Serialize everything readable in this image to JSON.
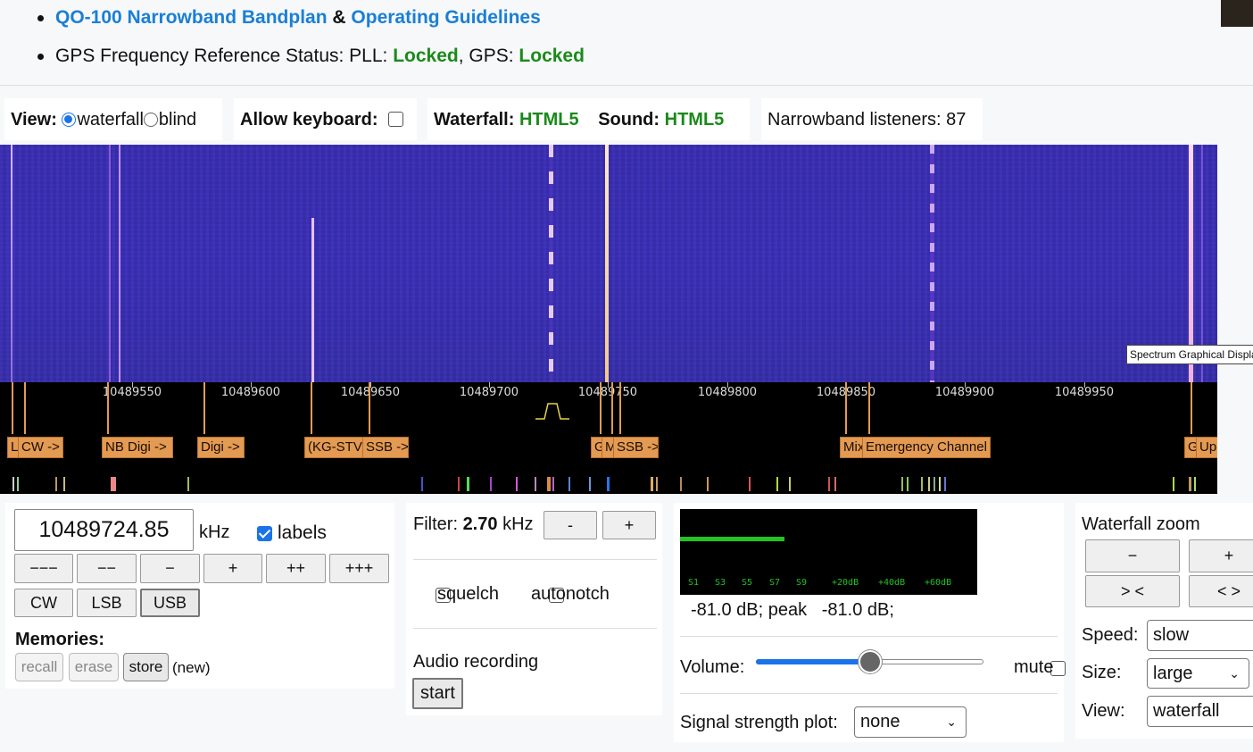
{
  "top_links": {
    "bandplan_link": "QO-100 Narrowband Bandplan",
    "amp": "&",
    "guidelines_link": "Operating Guidelines"
  },
  "gps_status": {
    "prefix": "GPS Frequency Reference Status: PLL: ",
    "pll": "Locked",
    "sep": ", GPS: ",
    "gps": "Locked"
  },
  "view_box": {
    "label": "View:",
    "opt_waterfall": "waterfall",
    "opt_blind": "blind",
    "selected": "waterfall"
  },
  "keyboard_box": {
    "label": "Allow keyboard:",
    "checked": false
  },
  "tech_box": {
    "waterfall_label": "Waterfall:",
    "waterfall_value": "HTML5",
    "sound_label": "Sound:",
    "sound_value": "HTML5"
  },
  "listeners": {
    "text": "Narrowband listeners: 87"
  },
  "scale": {
    "ticks": [
      {
        "label": "10489550"
      },
      {
        "label": "10489600"
      },
      {
        "label": "10489650"
      },
      {
        "label": "10489700"
      },
      {
        "label": "10489750"
      },
      {
        "label": "10489800"
      },
      {
        "label": "10489850"
      },
      {
        "label": "10489900"
      },
      {
        "label": "10489950"
      }
    ],
    "band_labels": [
      "L",
      "CW ->",
      "NB Digi ->",
      "Digi ->",
      "(KG-STV)",
      "SSB ->",
      "G",
      "M",
      "SSB ->",
      "Mix",
      "Emergency Channel",
      "G",
      "Upper Be"
    ]
  },
  "tooltip": {
    "text": "Spectrum Graphical Displa"
  },
  "tuning": {
    "frequency": "10489724.85",
    "unit": "kHz",
    "labels_text": "labels",
    "labels_checked": true,
    "step_buttons": [
      "−−−",
      "−−",
      "−",
      "+",
      "++",
      "+++"
    ],
    "modes": [
      "CW",
      "LSB",
      "USB"
    ],
    "active_mode": "USB"
  },
  "memories": {
    "title": "Memories:",
    "recall": "recall",
    "erase": "erase",
    "store": "store",
    "status": "(new)"
  },
  "filter": {
    "label": "Filter:",
    "value": "2.70",
    "unit": "kHz",
    "minus": "-",
    "plus": "+",
    "squelch": "squelch",
    "autonotch": "autonotch",
    "audio_recording": "Audio recording",
    "start": "start"
  },
  "smeter": {
    "level": -81.0,
    "scale_labels": [
      "S1",
      "S3",
      "S5",
      "S7",
      "S9",
      "+20dB",
      "+40dB",
      "+60dB"
    ],
    "readout": "-81.0 dB; peak   -81.0 dB;"
  },
  "volume": {
    "label": "Volume:",
    "level": 0.5,
    "mute": "mute"
  },
  "signal_plot": {
    "label": "Signal strength plot:",
    "value": "none"
  },
  "zoom_panel": {
    "title": "Waterfall zoom",
    "minus": "−",
    "plus": "+",
    "in": "> <",
    "out": "< >",
    "speed_label": "Speed:",
    "speed_value": "slow",
    "size_label": "Size:",
    "size_value": "large",
    "view_label": "View:",
    "view_value": "waterfall"
  },
  "colors": {
    "link": "#1a7fd6",
    "ok_green": "#1a8a1a",
    "band_label": "#e39a52",
    "waterfall_bg": "#3a2fb0",
    "smeter_green": "#22c322"
  }
}
